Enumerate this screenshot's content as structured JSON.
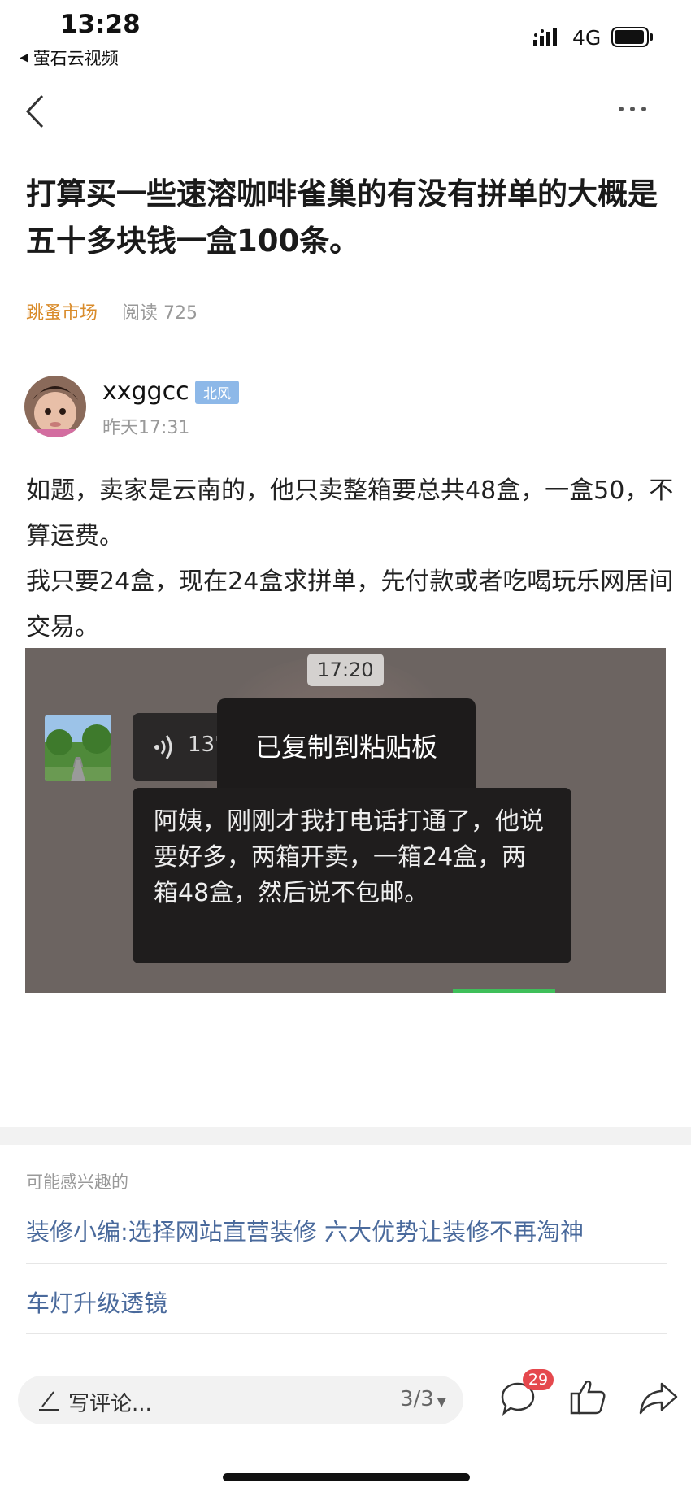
{
  "status_bar": {
    "time": "13:28",
    "back_app": "萤石云视频",
    "network": "4G"
  },
  "nav": {
    "back_icon": "chevron-left-icon",
    "more_icon": "more-dots-icon"
  },
  "post": {
    "title": "打算买一些速溶咖啡雀巢的有没有拼单的大概是五十多块钱一盒100条。",
    "forum": "跳蚤市场",
    "reads": "阅读 725",
    "author": {
      "name": "xxggcc",
      "badge": "北风",
      "time": "昨天17:31"
    },
    "body": [
      "如题，卖家是云南的，他只卖整箱要总共48盒，一盒50，不算运费。",
      "我只要24盒，现在24盒求拼单，先付款或者吃喝玩乐网居间交易。"
    ],
    "image": {
      "timestamp": "17:20",
      "voice_length": "13\"",
      "toast": "已复制到粘贴板",
      "message": "阿姨，刚刚才我打电话打通了，他说要好多，两箱开卖，一箱24盒，两箱48盒，然后说不包邮。"
    }
  },
  "recommendations": {
    "header": "可能感兴趣的",
    "items": [
      "装修小编:选择网站直营装修 六大优势让装修不再淘神",
      "车灯升级透镜"
    ]
  },
  "bottom_bar": {
    "comment_placeholder": "写评论...",
    "page_indicator": "3/3",
    "comment_count": "29"
  },
  "colors": {
    "forum": "#d98b2a",
    "link": "#4a6a9c",
    "badge": "#e5484d",
    "author_badge": "#8db8e8"
  }
}
